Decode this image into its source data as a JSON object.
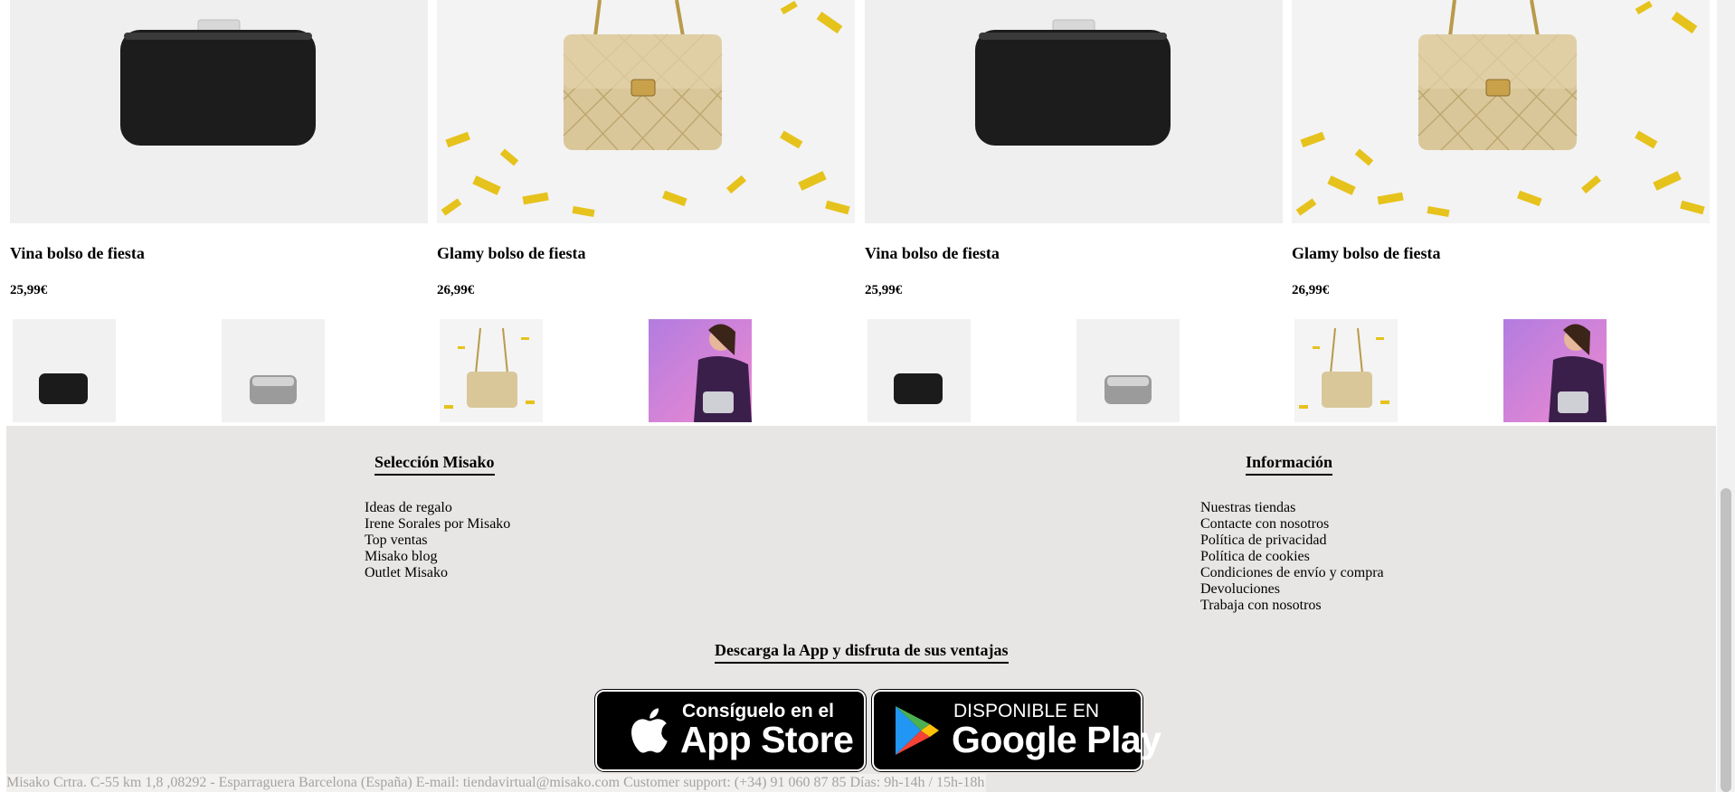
{
  "products": [
    {
      "name": "Vina bolso de fiesta",
      "price": "25,99€",
      "kind": "black-clutch"
    },
    {
      "name": "Glamy bolso de fiesta",
      "price": "26,99€",
      "kind": "gold-bag"
    },
    {
      "name": "Vina bolso de fiesta",
      "price": "25,99€",
      "kind": "black-clutch"
    },
    {
      "name": "Glamy bolso de fiesta",
      "price": "26,99€",
      "kind": "gold-bag"
    }
  ],
  "footer": {
    "seleccion": {
      "title": "Selección Misako",
      "links": [
        "Ideas de regalo",
        "Irene Sorales por Misako",
        "Top ventas",
        "Misako blog",
        "Outlet Misako"
      ]
    },
    "informacion": {
      "title": "Información",
      "links": [
        "Nuestras tiendas",
        "Contacte con nosotros",
        "Política de privacidad",
        "Política de cookies",
        "Condiciones de envío y compra",
        "Devoluciones",
        "Trabaja con nosotros"
      ]
    },
    "app_title": "Descarga la App y disfruta de sus ventajas",
    "app_store": {
      "small": "Consíguelo en el",
      "big": "App Store"
    },
    "google_play": {
      "small": "DISPONIBLE EN",
      "big": "Google Play"
    },
    "address": "Misako Crtra. C-55 km 1,8 ,08292 - Esparraguera Barcelona (España) E-mail: tiendavirtual@misako.com Customer support: (+34) 91 060 87 85 Días: 9h-14h / 15h-18h"
  },
  "colors": {
    "footer_bg": "#e8e6e5",
    "gold": "#d9c79a",
    "confetti": "#e6c21c"
  }
}
